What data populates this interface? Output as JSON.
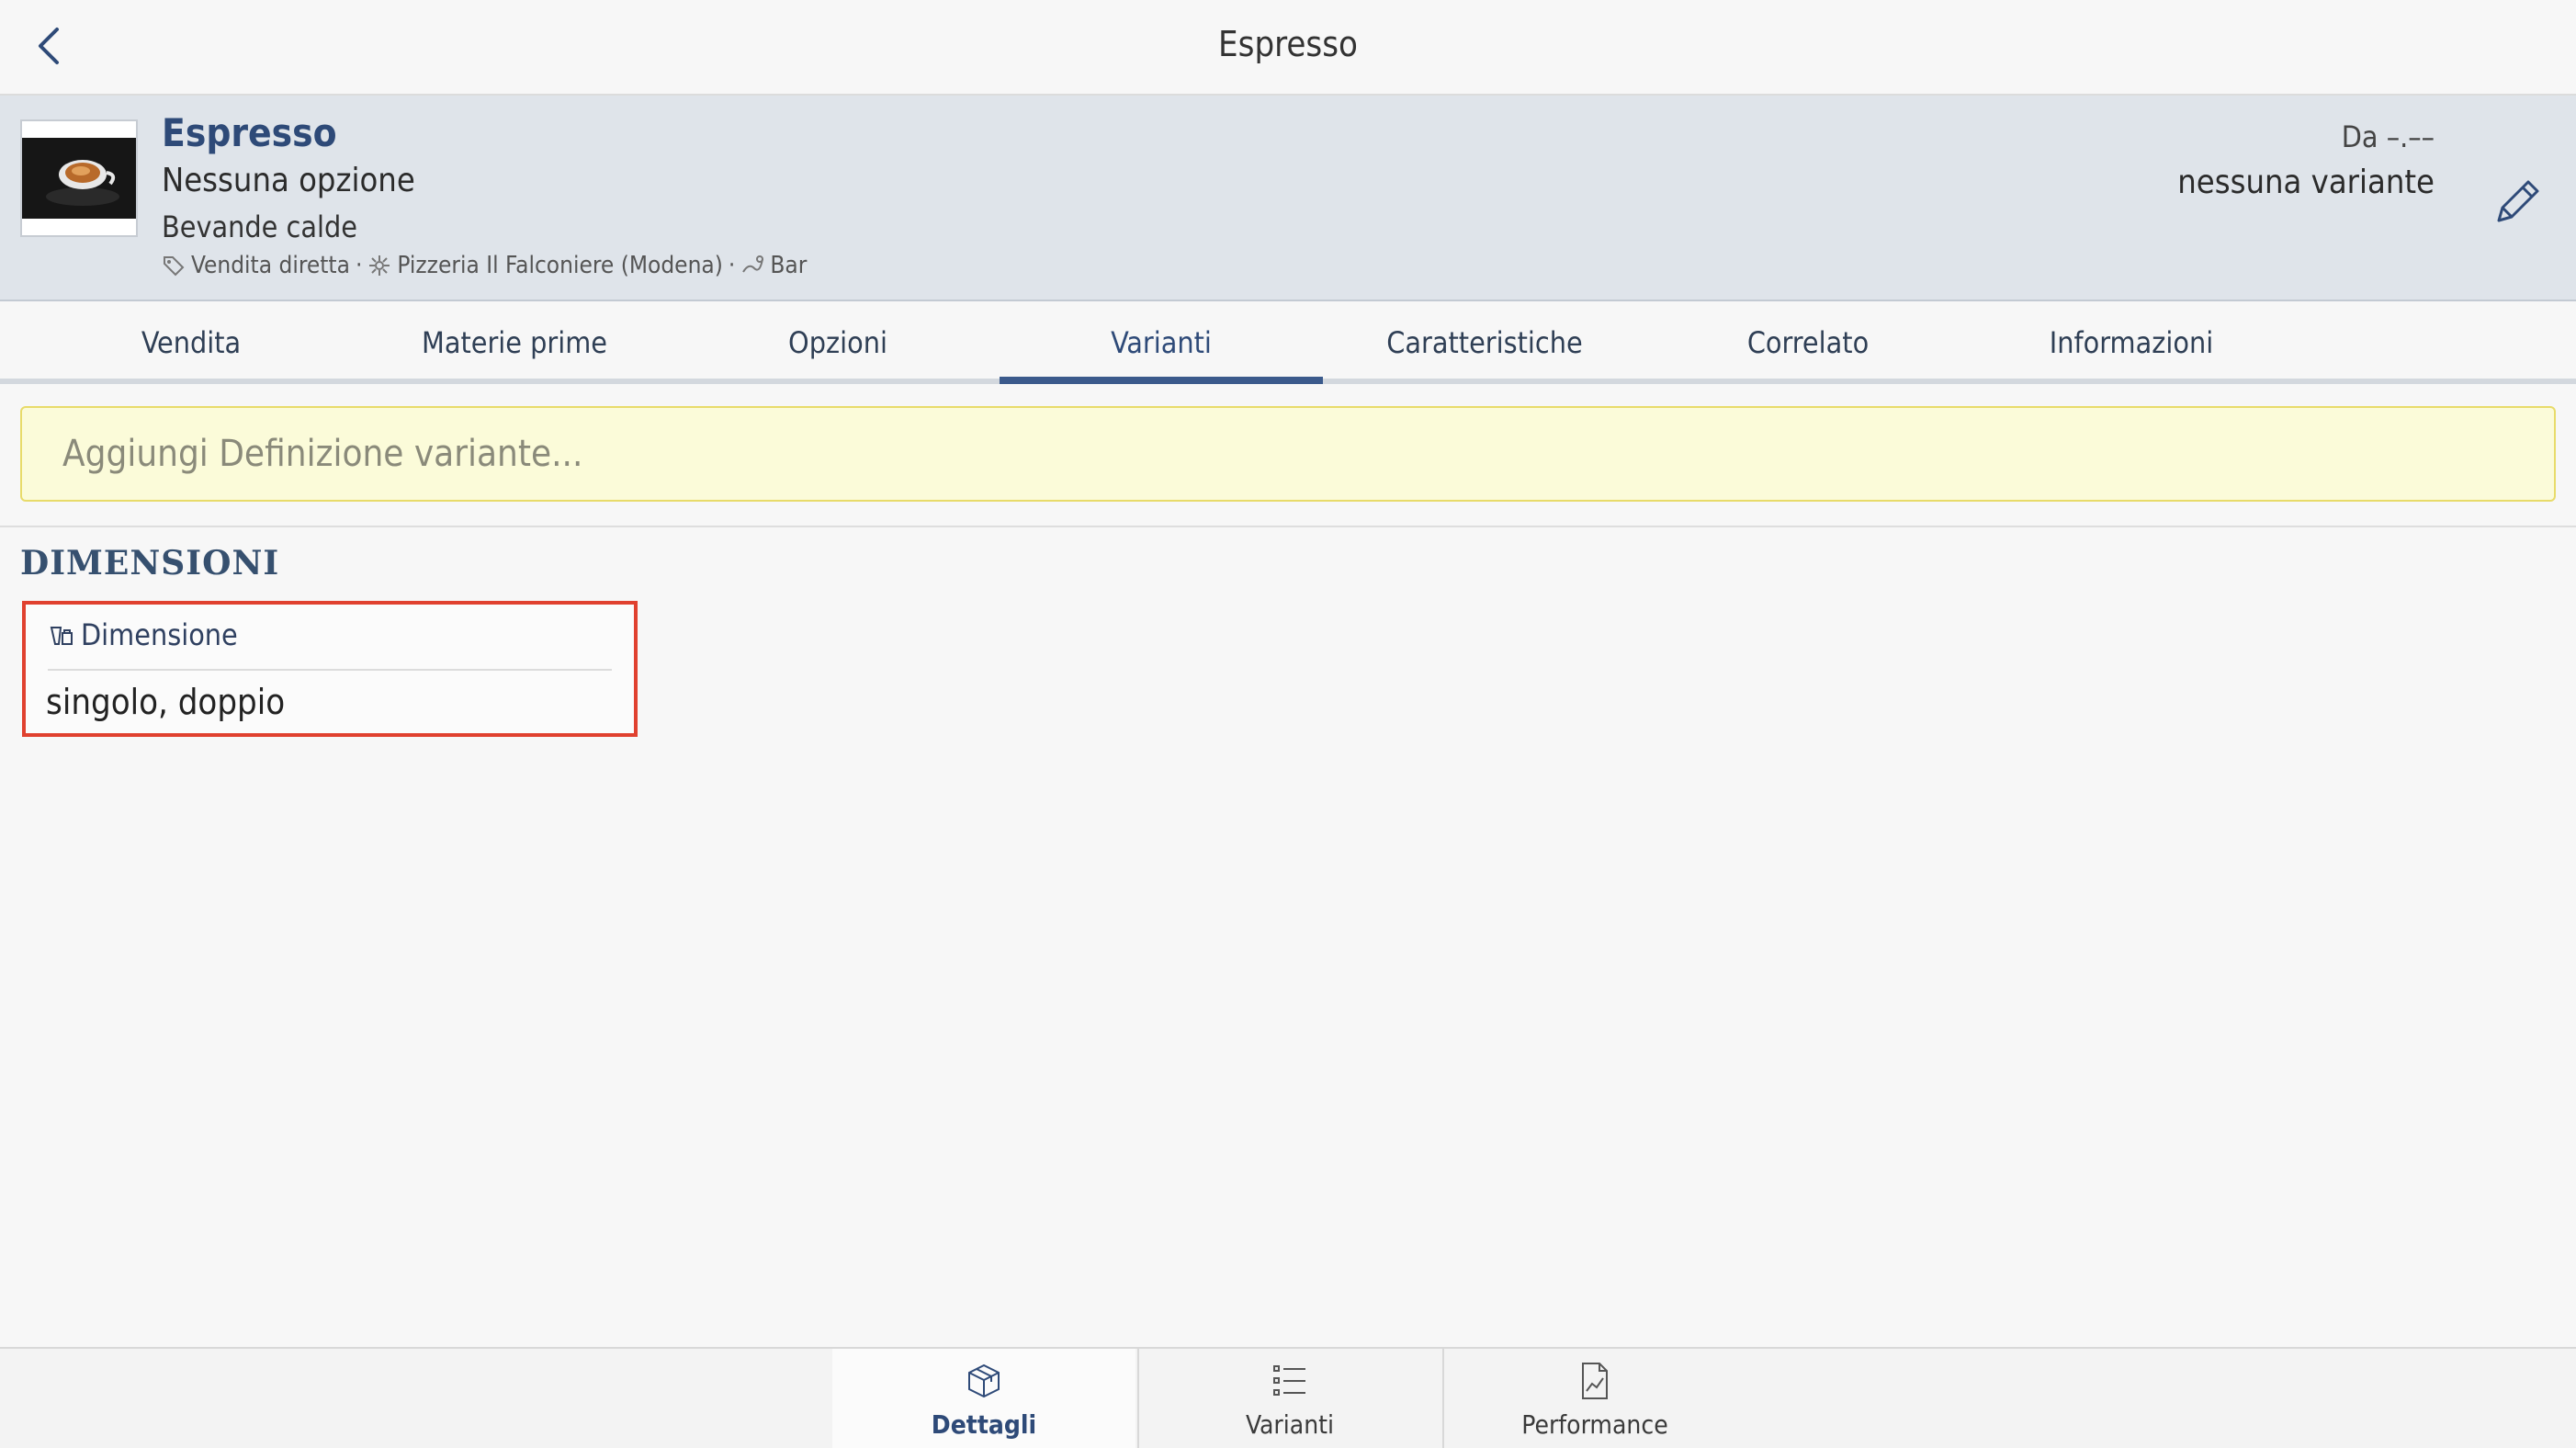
{
  "nav": {
    "title": "Espresso"
  },
  "product": {
    "name": "Espresso",
    "option": "Nessuna opzione",
    "category": "Bevande calde",
    "tags": [
      "Vendita diretta",
      "Pizzeria Il Falconiere (Modena)",
      "Bar"
    ],
    "tag_separator": "·",
    "price": "Da –.––",
    "variant_info": "nessuna variante"
  },
  "tabs": [
    {
      "label": "Vendita",
      "active": false
    },
    {
      "label": "Materie prime",
      "active": false
    },
    {
      "label": "Opzioni",
      "active": false
    },
    {
      "label": "Varianti",
      "active": true
    },
    {
      "label": "Caratteristiche",
      "active": false
    },
    {
      "label": "Correlato",
      "active": false
    },
    {
      "label": "Informazioni",
      "active": false
    }
  ],
  "add_variant": {
    "placeholder": "Aggiungi Definizione variante..."
  },
  "section": {
    "title": "DIMENSIONI",
    "card": {
      "label": "Dimensione",
      "value": "singolo, doppio"
    }
  },
  "bottom_tabs": [
    {
      "label": "Dettagli",
      "icon": "box-icon",
      "active": true
    },
    {
      "label": "Varianti",
      "icon": "list-icon",
      "active": false
    },
    {
      "label": "Performance",
      "icon": "chart-icon",
      "active": false
    }
  ],
  "colors": {
    "accent": "#2e4a78",
    "header_bg": "#dfe4ea",
    "highlight_border": "#e0412f",
    "add_box_bg": "#fbfbd9"
  }
}
